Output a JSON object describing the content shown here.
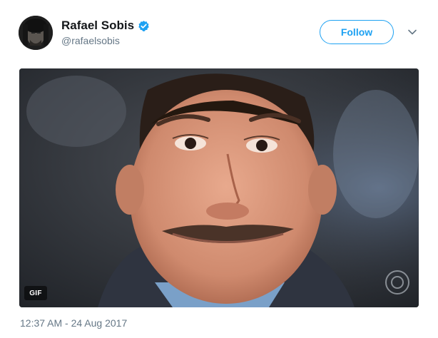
{
  "user": {
    "display_name": "Rafael Sobis",
    "handle": "@rafaelsobis",
    "verified": true
  },
  "follow_button": {
    "label": "Follow"
  },
  "media": {
    "badge": "GIF"
  },
  "timestamp": "12:37 AM - 24 Aug 2017",
  "colors": {
    "accent": "#1da1f2",
    "secondary_text": "#657786"
  },
  "icons": {
    "verified": "verified-badge-icon",
    "caret": "chevron-down-icon"
  }
}
